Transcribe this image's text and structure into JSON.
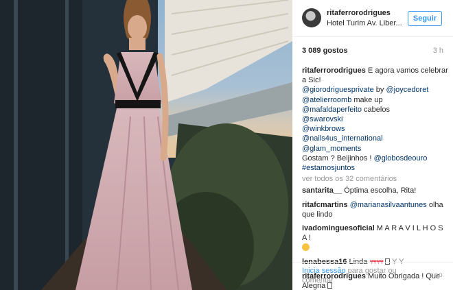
{
  "post": {
    "username": "ritaferrorodrigues",
    "location": "Hotel Turim Av. Liber...",
    "follow_label": "Seguir",
    "likes": "3 089 gostos",
    "age": "3 h"
  },
  "caption": {
    "username": "ritaferrorodrigues",
    "text": "E agora vamos celebrar",
    "text2": "a Sic!",
    "credits": [
      {
        "tag": "@giorodriguesprivate",
        "after": " by "
      },
      {
        "tag": "@joycedoret",
        "after": ""
      },
      {
        "tag": "@atelierroomb",
        "after": " make up"
      },
      {
        "tag": "@mafaldaperfeito",
        "after": " cabelos"
      },
      {
        "tag": "@swarovski",
        "after": ""
      },
      {
        "tag": "@winkbrows",
        "after": ""
      },
      {
        "tag": "@nails4us_international",
        "after": ""
      },
      {
        "tag": "@glam_moments",
        "after": ""
      }
    ],
    "closing": "Gostam ? Beijinhos ! ",
    "closing_tag": "@globosdeouro",
    "hashtag": "#estamosjuntos"
  },
  "view_all": "ver todos os 32 comentários",
  "comments": [
    {
      "user": "santarita__",
      "text": " Óptima escolha, Rita!"
    },
    {
      "user": "ritafcmartins",
      "mention": " @marianasilvaantunes",
      "text": " olha que lindo"
    },
    {
      "user": "ivadominguesoficial",
      "text": " M A R A V I L H O S A !"
    },
    {
      "user": "lenabessa16",
      "text": " Linda "
    },
    {
      "user": "ritaferrorodrigues",
      "text": " Muito Obrigada ! Que Alegria"
    }
  ],
  "footer": {
    "login": "Inicia sessão",
    "rest": " para gostar ou comentar",
    "more": "ooo"
  },
  "icons": {
    "heart": "heart-emoji",
    "smile": "smile-emoji",
    "glass": "cocktail-glass-emoji",
    "box": "missing-glyph-box"
  }
}
